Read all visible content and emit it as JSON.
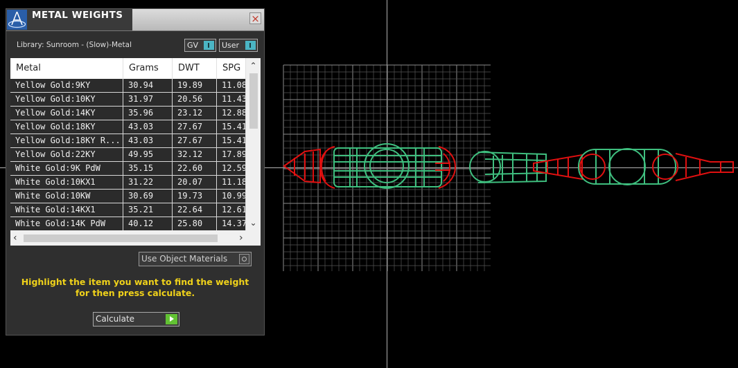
{
  "panel": {
    "title": "METAL WEIGHTS",
    "close_label": "×",
    "library": "Library: Sunroom - (Slow)-Metal",
    "gv_toggle": "GV",
    "user_toggle": "User"
  },
  "table": {
    "columns": [
      "Metal",
      "Grams",
      "DWT",
      "SPG"
    ],
    "rows": [
      [
        "Yellow Gold:9KY",
        "30.94",
        "19.89",
        "11.08"
      ],
      [
        "Yellow Gold:10KY",
        "31.97",
        "20.56",
        "11.43"
      ],
      [
        "Yellow Gold:14KY",
        "35.96",
        "23.12",
        "12.88"
      ],
      [
        "Yellow Gold:18KY",
        "43.03",
        "27.67",
        "15.41"
      ],
      [
        "Yellow Gold:18KY R...",
        "43.03",
        "27.67",
        "15.41"
      ],
      [
        "Yellow Gold:22KY",
        "49.95",
        "32.12",
        "17.89"
      ],
      [
        "White Gold:9K PdW",
        "35.15",
        "22.60",
        "12.59"
      ],
      [
        "White Gold:10KX1",
        "31.22",
        "20.07",
        "11.18"
      ],
      [
        "White Gold:10KW",
        "30.69",
        "19.73",
        "10.99"
      ],
      [
        "White Gold:14KX1",
        "35.21",
        "22.64",
        "12.61"
      ],
      [
        "White Gold:14K PdW",
        "40.12",
        "25.80",
        "14.37"
      ]
    ],
    "scroll_up": "⌃",
    "scroll_down": "⌄",
    "scroll_left": "‹",
    "scroll_right": "›"
  },
  "options": {
    "use_object_materials": "Use Object Materials"
  },
  "instructions": {
    "line1": "Highlight the item you want to find the weight",
    "line2": "for then press calculate."
  },
  "calculate_button": "Calculate",
  "colors": {
    "viewport_bg": "#000000",
    "grid": "#9a9a9a",
    "wire_red": "#e01010",
    "wire_green": "#3fbf7f",
    "panel_bg": "#2f2f2f",
    "accent_yellow": "#f0d21a",
    "toggle_teal": "#4bb5c4",
    "go_green": "#62c233"
  },
  "icons": {
    "title_icon": "app-logo-icon",
    "close": "close-icon",
    "go": "play-arrow-icon"
  }
}
